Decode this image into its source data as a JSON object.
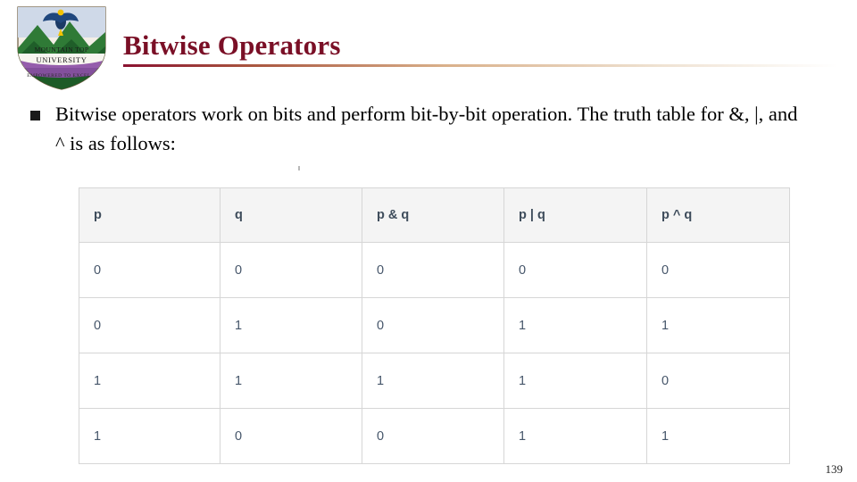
{
  "slide": {
    "title": "Bitwise Operators",
    "number": "139",
    "logo": {
      "name": "mountain-top-university-logo",
      "line1": "MOUNTAIN TOP",
      "line2": "UNIVERSITY",
      "motto": "EMPOWERED TO EXCEL"
    },
    "body": {
      "bullet_text": "Bitwise operators work on bits and perform bit-by-bit operation. The truth table for &, |, and ^ is as follows:"
    },
    "table": {
      "headers": [
        "p",
        "q",
        "p & q",
        "p | q",
        "p ^ q"
      ],
      "rows": [
        [
          "0",
          "0",
          "0",
          "0",
          "0"
        ],
        [
          "0",
          "1",
          "0",
          "1",
          "1"
        ],
        [
          "1",
          "1",
          "1",
          "1",
          "0"
        ],
        [
          "1",
          "0",
          "0",
          "1",
          "1"
        ]
      ]
    },
    "colors": {
      "title": "#7a0f26",
      "header_bg": "#f4f4f4",
      "cell_text": "#46566a",
      "border": "#d6d6d6"
    }
  }
}
